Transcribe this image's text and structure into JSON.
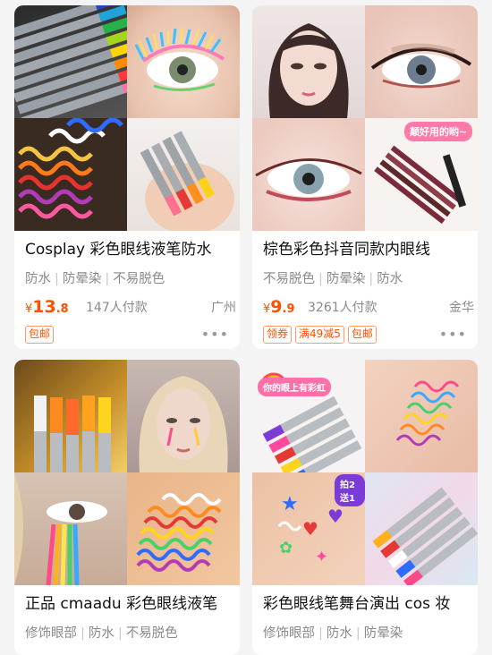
{
  "products": [
    {
      "title": "Cosplay 彩色眼线液笔防水",
      "tags": [
        "防水",
        "防晕染",
        "不易脱色"
      ],
      "currency": "¥",
      "price_int": "13",
      "price_dec": ".8",
      "sold": "147人付款",
      "location": "广州",
      "badges": [
        "包邮"
      ]
    },
    {
      "title": "棕色彩色抖音同款内眼线",
      "tags": [
        "不易脱色",
        "防晕染",
        "防水"
      ],
      "currency": "¥",
      "price_int": "9",
      "price_dec": ".9",
      "sold": "3261人付款",
      "location": "金华",
      "badges": [
        "领券",
        "满49减5",
        "包邮"
      ],
      "sticker": "颠好用的哟~"
    },
    {
      "title": "正品 cmaadu 彩色眼线液笔",
      "tags": [
        "修饰眼部",
        "防水",
        "不易脱色"
      ]
    },
    {
      "title": "彩色眼线笔舞台演出 cos 妆",
      "tags": [
        "修饰眼部",
        "防水",
        "防晕染"
      ],
      "banner": "你的眼上有彩虹",
      "sticker": "拍2送1"
    }
  ],
  "more_glyph": "•••",
  "colors": {
    "price": "#ff5000",
    "badge_border": "#ff9c6b",
    "meta": "#8a8a8a"
  }
}
